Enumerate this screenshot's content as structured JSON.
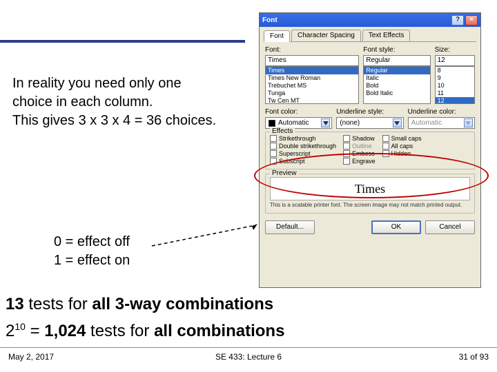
{
  "rule_color": "#2b3a8f",
  "left_text": {
    "line1": "In reality you need only one",
    "line2": "choice in each column.",
    "line3": "This gives 3 x 3 x 4 = 36 choices."
  },
  "legend": {
    "off": "0 = effect off",
    "on": "1 = effect on"
  },
  "stmt13_pre": "13",
  "stmt13_mid": " tests for ",
  "stmt13_bold": "all 3-way combinations",
  "stmt1024_base": "2",
  "stmt1024_exp": "10",
  "stmt1024_eq": " = ",
  "stmt1024_val": "1,024",
  "stmt1024_mid": " tests for ",
  "stmt1024_bold": "all combinations",
  "footer": {
    "left": "May 2, 2017",
    "mid": "SE 433: Lecture 6",
    "right": "31 of 93"
  },
  "dlg": {
    "title": "Font",
    "tabs": [
      "Font",
      "Character Spacing",
      "Text Effects"
    ],
    "font_label": "Font:",
    "font_value": "Times",
    "font_list": [
      "Times",
      "Times New Roman",
      "Trebuchet MS",
      "Tunga",
      "Tw Cen MT"
    ],
    "style_label": "Font style:",
    "style_value": "Regular",
    "style_list": [
      "Regular",
      "Italic",
      "Bold",
      "Bold Italic"
    ],
    "size_label": "Size:",
    "size_value": "12",
    "size_list": [
      "8",
      "9",
      "10",
      "11",
      "12"
    ],
    "fontcolor_label": "Font color:",
    "fontcolor_value": "Automatic",
    "underline_label": "Underline style:",
    "underline_value": "(none)",
    "ulcolor_label": "Underline color:",
    "ulcolor_value": "Automatic",
    "effects_label": "Effects",
    "effects": {
      "col1": [
        "Strikethrough",
        "Double strikethrough",
        "Superscript",
        "Subscript"
      ],
      "col2": [
        "Shadow",
        "Outline",
        "Emboss",
        "Engrave"
      ],
      "col3": [
        "Small caps",
        "All caps",
        "Hidden"
      ]
    },
    "preview_label": "Preview",
    "preview_text": "Times",
    "preview_note": "This is a scalable printer font. The screen image may not match printed output.",
    "btn_default": "Default...",
    "btn_ok": "OK",
    "btn_cancel": "Cancel"
  }
}
